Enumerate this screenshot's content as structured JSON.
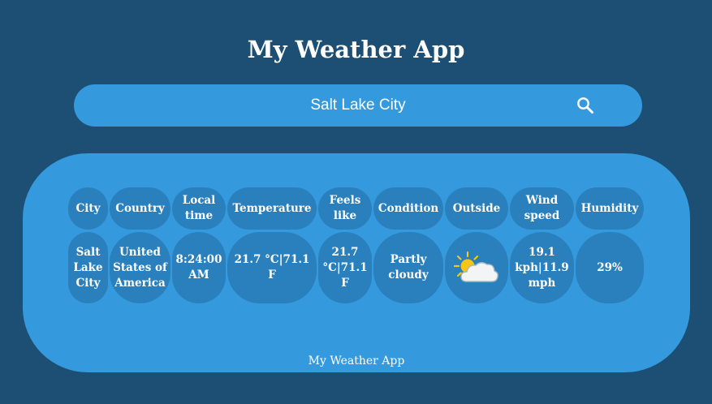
{
  "app": {
    "title": "My Weather App",
    "footer": "My Weather App"
  },
  "search": {
    "value": "Salt Lake City",
    "button_icon": "search-icon"
  },
  "weather_table": {
    "headers": {
      "city": "City",
      "country": "Country",
      "local_time": "Local time",
      "temperature": "Temperature",
      "feels_like": "Feels like",
      "condition": "Condition",
      "outside": "Outside",
      "wind_speed": "Wind speed",
      "humidity": "Humidity"
    },
    "values": {
      "city": "Salt Lake City",
      "country": "United States of America",
      "local_time": "8:24:00 AM",
      "temperature": "21.7 °C|71.1 F",
      "feels_like": "21.7 °C|71.1 F",
      "condition": "Partly cloudy",
      "outside_icon": "partly-cloudy-icon",
      "wind_speed": "19.1 kph|11.9 mph",
      "humidity": "29%"
    }
  },
  "colors": {
    "background": "#1c4f73",
    "panel": "#3599dd",
    "cell": "#2a80bd",
    "sun": "#f5c518",
    "cloud": "#f2f4f6"
  }
}
